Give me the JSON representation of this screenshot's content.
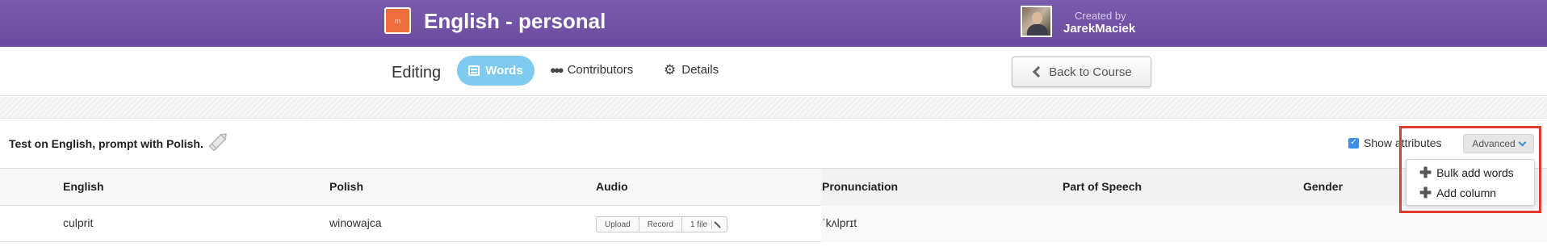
{
  "header": {
    "course_title": "English - personal",
    "course_thumb_text": "m",
    "created_by_label": "Created by",
    "creator_name": "JarekMaciek"
  },
  "nav": {
    "editing_label": "Editing",
    "tabs": [
      {
        "label": "Words",
        "icon": "list-icon",
        "active": true
      },
      {
        "label": "Contributors",
        "icon": "people-icon",
        "active": false
      },
      {
        "label": "Details",
        "icon": "gear-icon",
        "active": false
      }
    ],
    "back_button": "Back to Course"
  },
  "test": {
    "description": "Test on English, prompt with Polish."
  },
  "controls": {
    "show_attributes_label": "Show attributes",
    "show_attributes_checked": true,
    "advanced_label": "Advanced",
    "dropdown_items": [
      {
        "label": "Bulk add words",
        "icon": "plus-icon"
      },
      {
        "label": "Add column",
        "icon": "plus-icon"
      }
    ]
  },
  "table": {
    "columns": [
      "English",
      "Polish",
      "Audio",
      "Pronunciation",
      "Part of Speech",
      "Gender"
    ],
    "rows": [
      {
        "english": "culprit",
        "polish": "winowajca",
        "audio": {
          "upload": "Upload",
          "record": "Record",
          "files": "1 file"
        },
        "pronunciation": "ˈkʌlprɪt",
        "part_of_speech": "",
        "gender": ""
      }
    ]
  },
  "colors": {
    "header_bg": "#6a4b9f",
    "active_tab": "#7ecbef",
    "course_thumb": "#ee6e3c",
    "highlight": "#e23b2a",
    "checkbox": "#3f8ee6"
  }
}
